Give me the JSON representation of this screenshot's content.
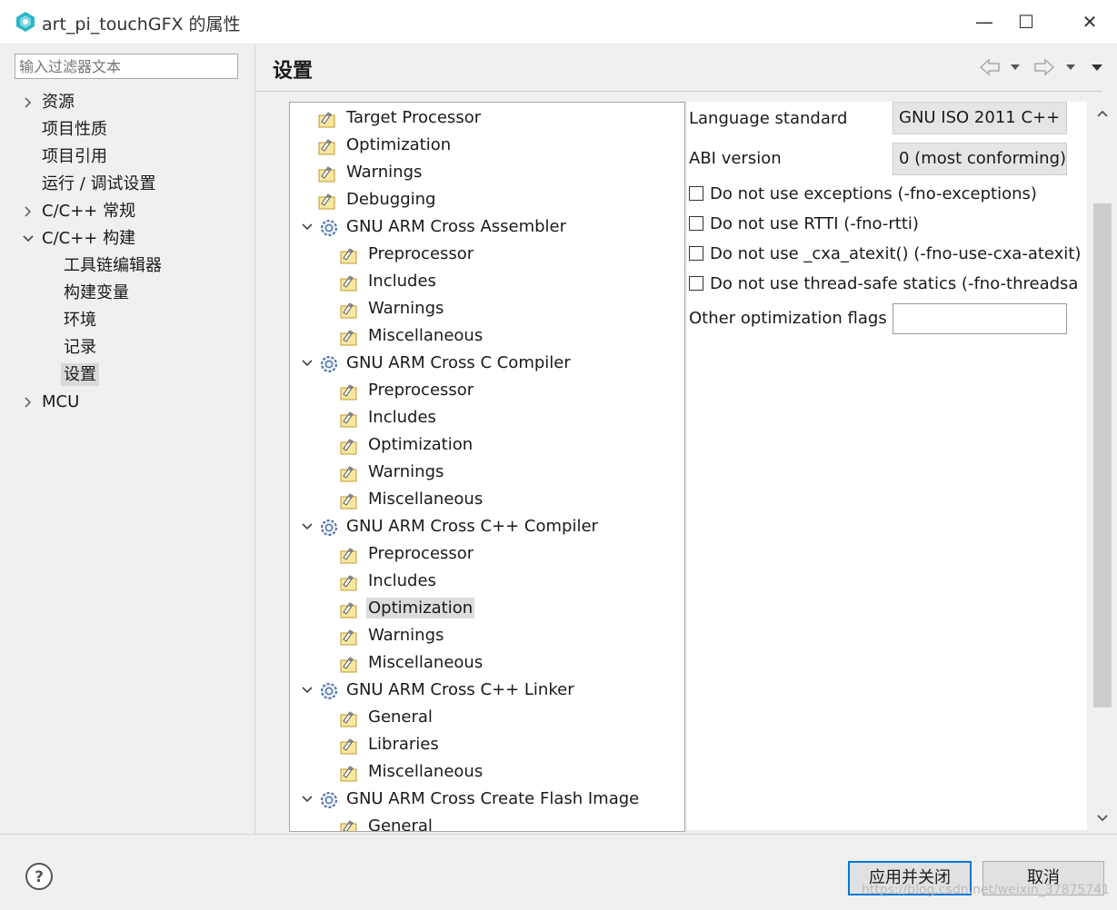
{
  "window": {
    "title": "art_pi_touchGFX 的属性",
    "minimize": "—",
    "maximize": "☐",
    "close": "✕"
  },
  "sidebar": {
    "filter_placeholder": "输入过滤器文本",
    "items": [
      {
        "label": "资源"
      },
      {
        "label": "项目性质"
      },
      {
        "label": "项目引用"
      },
      {
        "label": "运行 / 调试设置"
      },
      {
        "label": "C/C++ 常规"
      },
      {
        "label": "C/C++ 构建"
      },
      {
        "label": "工具链编辑器"
      },
      {
        "label": "构建变量"
      },
      {
        "label": "环境"
      },
      {
        "label": "记录"
      },
      {
        "label": "设置"
      },
      {
        "label": "MCU"
      }
    ]
  },
  "page": {
    "title": "设置"
  },
  "tree": {
    "items": [
      {
        "label": "Target Processor"
      },
      {
        "label": "Optimization"
      },
      {
        "label": "Warnings"
      },
      {
        "label": "Debugging"
      },
      {
        "label": "GNU ARM Cross Assembler"
      },
      {
        "label": "Preprocessor"
      },
      {
        "label": "Includes"
      },
      {
        "label": "Warnings"
      },
      {
        "label": "Miscellaneous"
      },
      {
        "label": "GNU ARM Cross C Compiler"
      },
      {
        "label": "Preprocessor"
      },
      {
        "label": "Includes"
      },
      {
        "label": "Optimization"
      },
      {
        "label": "Warnings"
      },
      {
        "label": "Miscellaneous"
      },
      {
        "label": "GNU ARM Cross C++ Compiler"
      },
      {
        "label": "Preprocessor"
      },
      {
        "label": "Includes"
      },
      {
        "label": "Optimization"
      },
      {
        "label": "Warnings"
      },
      {
        "label": "Miscellaneous"
      },
      {
        "label": "GNU ARM Cross C++ Linker"
      },
      {
        "label": "General"
      },
      {
        "label": "Libraries"
      },
      {
        "label": "Miscellaneous"
      },
      {
        "label": "GNU ARM Cross Create Flash Image"
      },
      {
        "label": "General"
      }
    ]
  },
  "options": {
    "language_standard_label": "Language standard",
    "language_standard_value": "GNU ISO 2011 C++ (",
    "abi_version_label": "ABI version",
    "abi_version_value": "0 (most conforming)",
    "no_exceptions": "Do not use exceptions (-fno-exceptions)",
    "no_rtti": "Do not use RTTI (-fno-rtti)",
    "no_cxa_atexit": "Do not use _cxa_atexit() (-fno-use-cxa-atexit)",
    "no_threadsafe_statics": "Do not use thread-safe statics (-fno-threadsa",
    "other_flags_label": "Other optimization flags",
    "other_flags_value": ""
  },
  "footer": {
    "apply_close": "应用并关闭",
    "cancel": "取消",
    "watermark": "https://blog.csdn.net/weixin_37875741"
  },
  "colors": {
    "selection": "#d9d9d9",
    "primary_border": "#0078d7",
    "window_bg": "#f0f0f0"
  }
}
